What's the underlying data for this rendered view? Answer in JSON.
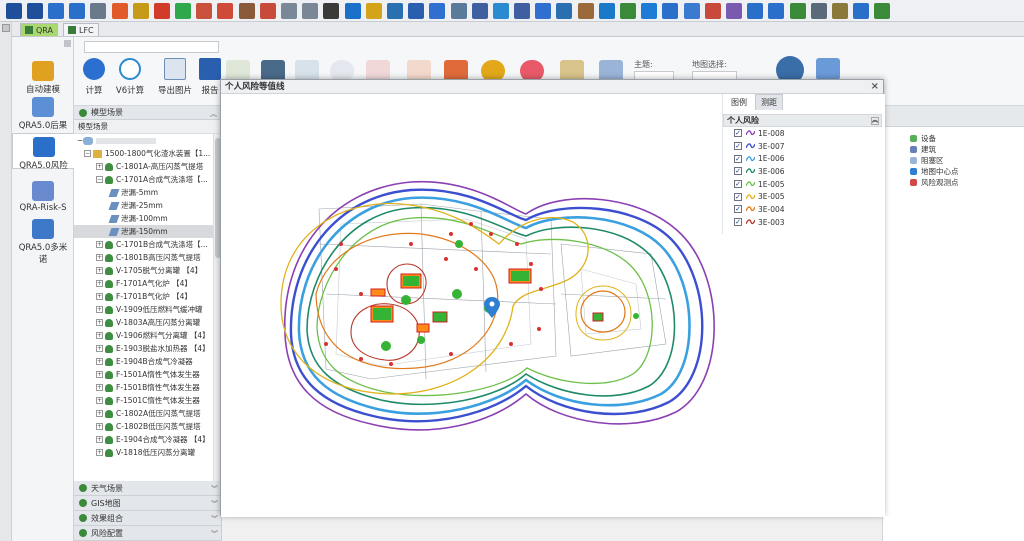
{
  "toolbar": {
    "icon_colors": [
      "#1f4e9a",
      "#1f4e9a",
      "#2a6fc9",
      "#2a6fc9",
      "#6b7a8a",
      "#e05a2a",
      "#c89a1a",
      "#d23a2a",
      "#2ea84a",
      "#c9503a",
      "#d04a3a",
      "#8a5a3a",
      "#c84a3a",
      "#7a8797",
      "#7a8797",
      "#3a3a3a",
      "#1a6fc9",
      "#d3a31a",
      "#2a70b0",
      "#2a5fb0",
      "#2f6fd0",
      "#5a7a9a",
      "#3f5fa0",
      "#2a8bd0",
      "#3f5fa0",
      "#2f6fd0",
      "#2a70b0",
      "#9a6a3a",
      "#1a7ac9",
      "#3a8a3a",
      "#1e7bd6",
      "#2a6fc9",
      "#3a7acf",
      "#c84a3a",
      "#7a5ab0",
      "#2a6fc9",
      "#2a6fc9",
      "#3a8a3a",
      "#5a6a7a",
      "#8a7a3a",
      "#2a6fc9",
      "#3a8a3a"
    ]
  },
  "tabs": [
    {
      "label": "QRA",
      "active": true
    },
    {
      "label": "LFC",
      "active": false
    }
  ],
  "nav": {
    "items": [
      {
        "label": "自动建模",
        "color": "#e0a020"
      },
      {
        "label": "QRA5.0后果",
        "color": "#5b8fd6"
      },
      {
        "label": "QRA5.0风险",
        "color": "#2a6fc9"
      },
      {
        "label": "QRA-Risk-S",
        "color": "#6a8ad0"
      },
      {
        "label": "QRA5.0多米诺",
        "color": "#3d79c8"
      }
    ]
  },
  "ribbon": {
    "buttons": [
      {
        "label": "计算",
        "color": "#2b6fd0"
      },
      {
        "label": "V6计算",
        "color": "#2b8bd0"
      },
      {
        "label": "导出图片",
        "color": "#6e8fb5"
      },
      {
        "label": "报告",
        "color": "#2a5fb0"
      }
    ],
    "theme_label": "主题:",
    "map_label": "地图选择:"
  },
  "tree": {
    "model_scene_title": "模型场景",
    "model_scene_sub": "模型场景",
    "rows": [
      {
        "text": "1500-1800气化渣水装置【1...",
        "level": 1,
        "kind": "folder"
      },
      {
        "text": "C-1801A-高压闪蒸气提塔",
        "level": 2,
        "kind": "leaf"
      },
      {
        "text": "C-1701A合成气洗涤塔【...",
        "level": 2,
        "kind": "leaf"
      },
      {
        "text": "泄漏-5mm",
        "level": 3,
        "kind": "pipe"
      },
      {
        "text": "泄漏-25mm",
        "level": 3,
        "kind": "pipe"
      },
      {
        "text": "泄漏-100mm",
        "level": 3,
        "kind": "pipe"
      },
      {
        "text": "泄漏-150mm",
        "level": 3,
        "kind": "pipe",
        "selected": true
      },
      {
        "text": "C-1701B合成气洗涤塔【...",
        "level": 2,
        "kind": "leaf"
      },
      {
        "text": "C-1801B高压闪蒸气提塔",
        "level": 2,
        "kind": "leaf"
      },
      {
        "text": "V-1705脱气分离罐 【4】",
        "level": 2,
        "kind": "leaf"
      },
      {
        "text": "F-1701A气化炉 【4】",
        "level": 2,
        "kind": "leaf"
      },
      {
        "text": "F-1701B气化炉 【4】",
        "level": 2,
        "kind": "leaf"
      },
      {
        "text": "V-1909低压燃料气缓冲罐",
        "level": 2,
        "kind": "leaf"
      },
      {
        "text": "V-1803A高压闪蒸分离罐",
        "level": 2,
        "kind": "leaf"
      },
      {
        "text": "V-1906燃料气分离罐 【4】",
        "level": 2,
        "kind": "leaf"
      },
      {
        "text": "E-1903脱盐水加热器 【4】",
        "level": 2,
        "kind": "leaf"
      },
      {
        "text": "E-1904B合成气冷凝器",
        "level": 2,
        "kind": "leaf"
      },
      {
        "text": "F-1501A惰性气体发生器",
        "level": 2,
        "kind": "leaf"
      },
      {
        "text": "F-1501B惰性气体发生器",
        "level": 2,
        "kind": "leaf"
      },
      {
        "text": "F-1501C惰性气体发生器",
        "level": 2,
        "kind": "leaf"
      },
      {
        "text": "C-1802A低压闪蒸气提塔",
        "level": 2,
        "kind": "leaf"
      },
      {
        "text": "C-1802B低压闪蒸气提塔",
        "level": 2,
        "kind": "leaf"
      },
      {
        "text": "E-1904合成气冷凝器 【4】",
        "level": 2,
        "kind": "leaf"
      },
      {
        "text": "V-1818低压闪蒸分离罐",
        "level": 2,
        "kind": "leaf"
      }
    ],
    "bottom_sections": [
      "天气场景",
      "GIS地图",
      "效果组合",
      "风险配置"
    ]
  },
  "dialog": {
    "title": "个人风险等值线",
    "close": "×"
  },
  "legend": {
    "tabs": [
      {
        "label": "图例",
        "active": false
      },
      {
        "label": "测距",
        "active": true
      }
    ],
    "section_title": "个人风险",
    "items": [
      {
        "label": "1E-008",
        "color": "#8a3fb3"
      },
      {
        "label": "3E-007",
        "color": "#3b4fd0"
      },
      {
        "label": "1E-006",
        "color": "#3aa0e0"
      },
      {
        "label": "3E-006",
        "color": "#1f8a6a"
      },
      {
        "label": "1E-005",
        "color": "#6cc04a"
      },
      {
        "label": "3E-005",
        "color": "#e0b21a"
      },
      {
        "label": "3E-004",
        "color": "#e07a1a"
      },
      {
        "label": "3E-003",
        "color": "#b73a2a"
      }
    ]
  },
  "right_panel": {
    "items": [
      {
        "label": "设备",
        "color": "#56b05a"
      },
      {
        "label": "建筑",
        "color": "#6a7fb8"
      },
      {
        "label": "阻塞区",
        "color": "#9ab4d8"
      },
      {
        "label": "地图中心点",
        "color": "#2f7fd0"
      },
      {
        "label": "风险观测点",
        "color": "#d04a4a"
      }
    ]
  }
}
